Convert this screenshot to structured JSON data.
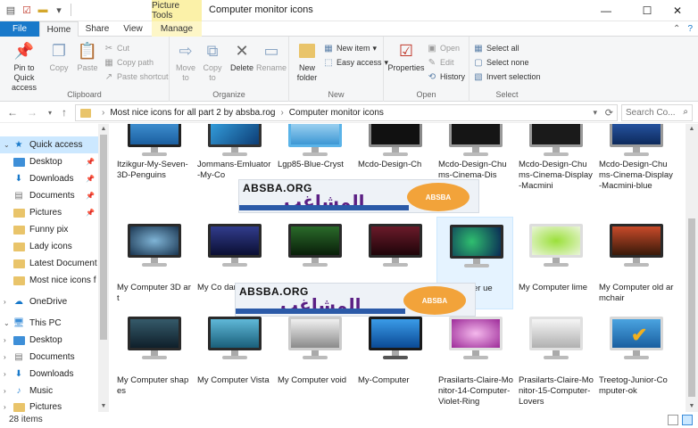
{
  "window": {
    "title": "Computer monitor icons",
    "context_tab_title": "Picture Tools",
    "controls": {
      "minimize": "—",
      "maximize": "☐",
      "close": "✕"
    }
  },
  "quick_access_toolbar": {
    "icons": [
      "properties-icon",
      "new-folder-icon",
      "customize-icon"
    ]
  },
  "tabs": [
    "File",
    "Home",
    "Share",
    "View",
    "Manage"
  ],
  "ribbon": {
    "clipboard": {
      "label": "Clipboard",
      "pin": "Pin to Quick access",
      "copy": "Copy",
      "paste": "Paste",
      "cut": "Cut",
      "copy_path": "Copy path",
      "paste_shortcut": "Paste shortcut"
    },
    "organize": {
      "label": "Organize",
      "move_to": "Move to",
      "copy_to": "Copy to",
      "delete": "Delete",
      "rename": "Rename"
    },
    "new": {
      "label": "New",
      "new_folder": "New folder",
      "new_item": "New item",
      "easy_access": "Easy access"
    },
    "open": {
      "label": "Open",
      "properties": "Properties",
      "open": "Open",
      "edit": "Edit",
      "history": "History"
    },
    "select": {
      "label": "Select",
      "select_all": "Select all",
      "select_none": "Select none",
      "invert_selection": "Invert selection"
    }
  },
  "address_bar": {
    "crumbs": [
      "Most nice icons for all part 2 by absba.rog",
      "Computer monitor icons"
    ],
    "search_placeholder": "Search Co..."
  },
  "nav_pane": {
    "items": [
      {
        "label": "Quick access",
        "icon": "star-icon",
        "pinned": false
      },
      {
        "label": "Desktop",
        "icon": "desktop-folder-icon",
        "pinned": true
      },
      {
        "label": "Downloads",
        "icon": "downloads-folder-icon",
        "pinned": true
      },
      {
        "label": "Documents",
        "icon": "documents-folder-icon",
        "pinned": true
      },
      {
        "label": "Pictures",
        "icon": "pictures-folder-icon",
        "pinned": true
      },
      {
        "label": "Funny pix",
        "icon": "folder-icon",
        "pinned": false
      },
      {
        "label": "Lady icons",
        "icon": "folder-icon",
        "pinned": false
      },
      {
        "label": "Latest Document",
        "icon": "folder-icon",
        "pinned": false
      },
      {
        "label": "Most nice icons f",
        "icon": "folder-icon",
        "pinned": false
      },
      {
        "label": "OneDrive",
        "icon": "cloud-icon",
        "pinned": false
      },
      {
        "label": "This PC",
        "icon": "computer-icon",
        "pinned": false
      },
      {
        "label": "Desktop",
        "icon": "desktop-folder-icon",
        "pinned": false
      },
      {
        "label": "Documents",
        "icon": "documents-folder-icon",
        "pinned": false
      },
      {
        "label": "Downloads",
        "icon": "downloads-folder-icon",
        "pinned": false
      },
      {
        "label": "Music",
        "icon": "music-folder-icon",
        "pinned": false
      },
      {
        "label": "Pictures",
        "icon": "pictures-folder-icon",
        "pinned": false
      }
    ]
  },
  "files": {
    "row1": [
      "Itzikgur-My-Seven-3D-Penguins",
      "Jommans-Emluator-My-Co",
      "Lgp85-Blue-Cryst",
      "Mcdo-Design-Ch",
      "Mcdo-Design-Chums-Cinema-Dis",
      "Mcdo-Design-Chums-Cinema-Display-Macmini",
      "Mcdo-Design-Chums-Cinema-Display-Macmini-blue"
    ],
    "row2": [
      "My Computer 3D art",
      "My Co dark b",
      "",
      "",
      "er ue",
      "My Computer lime",
      "My Computer old armchair"
    ],
    "row3": [
      "My Computer shapes",
      "My Computer Vista",
      "My Computer void",
      "My-Computer",
      "Prasilarts-Claire-Monitor-14-Computer-Violet-Ring",
      "Prasilarts-Claire-Monitor-15-Computer-Lovers",
      "Treetog-Junior-Computer-ok"
    ]
  },
  "watermark": {
    "english": "ABSBA.ORG",
    "arabic": "المشاغب",
    "logo_text": "ABSBA"
  },
  "status": {
    "item_count": "28 items"
  },
  "colors": {
    "accent": "#1979ca",
    "selection": "#cce8ff",
    "context_tab": "#fbf1a8"
  }
}
